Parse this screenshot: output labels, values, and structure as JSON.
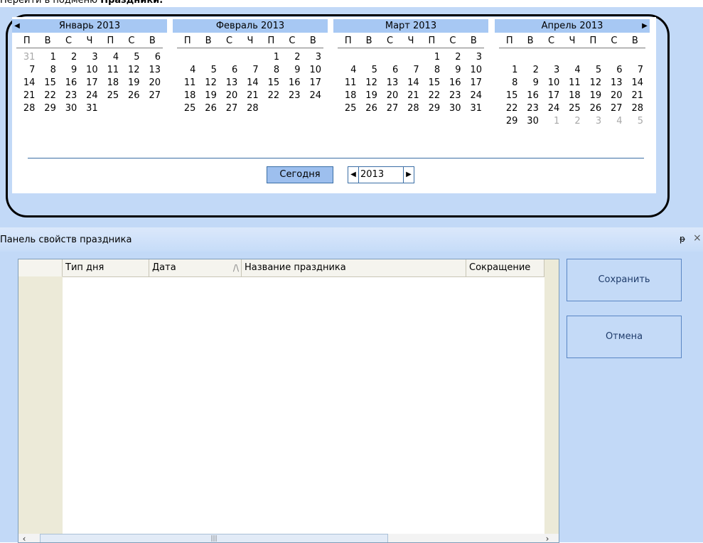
{
  "caption": {
    "text": "Перейти в подменю ",
    "bold": "Праздники."
  },
  "calendar": {
    "months": [
      {
        "title": "Январь 2013",
        "days": [
          "31",
          "1",
          "2",
          "3",
          "4",
          "5",
          "6",
          "7",
          "8",
          "9",
          "10",
          "11",
          "12",
          "13",
          "14",
          "15",
          "16",
          "17",
          "18",
          "19",
          "20",
          "21",
          "22",
          "23",
          "24",
          "25",
          "26",
          "27",
          "28",
          "29",
          "30",
          "31"
        ],
        "other_before": 1,
        "other_after": 0,
        "offset": 0
      },
      {
        "title": "Февраль 2013",
        "days": [
          "1",
          "2",
          "3",
          "4",
          "5",
          "6",
          "7",
          "8",
          "9",
          "10",
          "11",
          "12",
          "13",
          "14",
          "15",
          "16",
          "17",
          "18",
          "19",
          "20",
          "21",
          "22",
          "23",
          "24",
          "25",
          "26",
          "27",
          "28"
        ],
        "other_before": 0,
        "other_after": 0,
        "offset": 4
      },
      {
        "title": "Март 2013",
        "days": [
          "1",
          "2",
          "3",
          "4",
          "5",
          "6",
          "7",
          "8",
          "9",
          "10",
          "11",
          "12",
          "13",
          "14",
          "15",
          "16",
          "17",
          "18",
          "19",
          "20",
          "21",
          "22",
          "23",
          "24",
          "25",
          "26",
          "27",
          "28",
          "29",
          "30",
          "31"
        ],
        "other_before": 0,
        "other_after": 0,
        "offset": 4
      },
      {
        "title": "Апрель 2013",
        "days": [
          "1",
          "2",
          "3",
          "4",
          "5",
          "6",
          "7",
          "8",
          "9",
          "10",
          "11",
          "12",
          "13",
          "14",
          "15",
          "16",
          "17",
          "18",
          "19",
          "20",
          "21",
          "22",
          "23",
          "24",
          "25",
          "26",
          "27",
          "28",
          "29",
          "30",
          "1",
          "2",
          "3",
          "4",
          "5"
        ],
        "other_before": 0,
        "other_after": 5,
        "offset": 7
      }
    ],
    "weekdays": [
      "П",
      "В",
      "С",
      "Ч",
      "П",
      "С",
      "В"
    ],
    "today_label": "Сегодня",
    "year": "2013"
  },
  "props_panel": {
    "title": "Панель свойств праздника",
    "pin": "ᵽ",
    "close": "×",
    "columns": [
      "Тип дня",
      "Дата",
      "Название праздника",
      "Сокращение"
    ],
    "save_label": "Сохранить",
    "cancel_label": "Отмена"
  },
  "colors": {
    "panel_bg": "#c2d9f7",
    "month_header": "#a7c8f3",
    "other_month_day": "#a8a8a8"
  }
}
